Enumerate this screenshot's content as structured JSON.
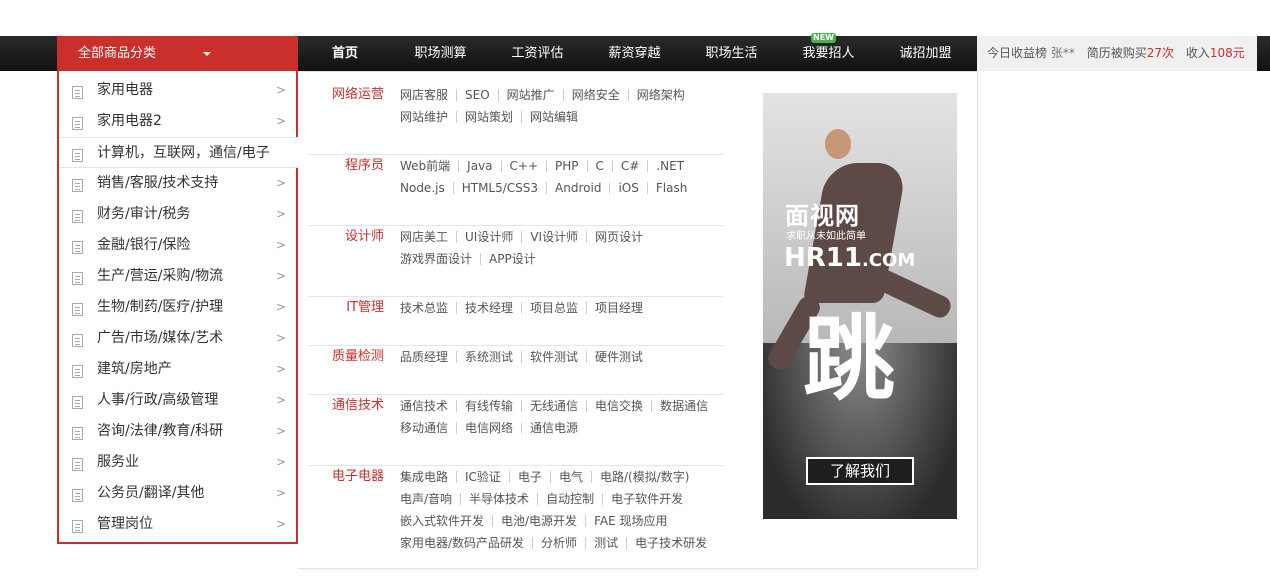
{
  "category_header": {
    "label": "全部商品分类"
  },
  "nav": {
    "items": [
      {
        "label": "首页"
      },
      {
        "label": "职场测算"
      },
      {
        "label": "工资评估"
      },
      {
        "label": "薪资穿越"
      },
      {
        "label": "职场生活"
      },
      {
        "label": "我要招人",
        "badge": "NEW"
      },
      {
        "label": "诚招加盟"
      }
    ]
  },
  "stats": {
    "label": "今日收益榜",
    "user": "张**",
    "resume_prefix": "简历被购买",
    "resume_count": "27次",
    "income_prefix": "收入",
    "income_value": "108元"
  },
  "sidebar": {
    "items": [
      {
        "label": "家用电器"
      },
      {
        "label": "家用电器2"
      },
      {
        "label": "计算机，互联网，通信/电子"
      },
      {
        "label": "销售/客服/技术支持"
      },
      {
        "label": "财务/审计/税务"
      },
      {
        "label": "金融/银行/保险"
      },
      {
        "label": "生产/营运/采购/物流"
      },
      {
        "label": "生物/制药/医疗/护理"
      },
      {
        "label": "广告/市场/媒体/艺术"
      },
      {
        "label": "建筑/房地产"
      },
      {
        "label": "人事/行政/高级管理"
      },
      {
        "label": "咨询/法律/教育/科研"
      },
      {
        "label": "服务业"
      },
      {
        "label": "公务员/翻译/其他"
      },
      {
        "label": "管理岗位"
      }
    ]
  },
  "groups": [
    {
      "title": "网络运营",
      "rows": [
        [
          "网店客服",
          "SEO",
          "网站推广",
          "网络安全",
          "网络架构"
        ],
        [
          "网站维护",
          "网站策划",
          "网站编辑"
        ]
      ]
    },
    {
      "title": "程序员",
      "rows": [
        [
          "Web前端",
          "Java",
          "C++",
          "PHP",
          "C",
          "C#",
          ".NET"
        ],
        [
          "Node.js",
          "HTML5/CSS3",
          "Android",
          "iOS",
          "Flash"
        ]
      ]
    },
    {
      "title": "设计师",
      "rows": [
        [
          "网店美工",
          "UI设计师",
          "VI设计师",
          "网页设计"
        ],
        [
          "游戏界面设计",
          "APP设计"
        ]
      ]
    },
    {
      "title": "IT管理",
      "rows": [
        [
          "技术总监",
          "技术经理",
          "项目总监",
          "项目经理"
        ]
      ]
    },
    {
      "title": "质量检测",
      "rows": [
        [
          "品质经理",
          "系统测试",
          "软件测试",
          "硬件测试"
        ]
      ]
    },
    {
      "title": "通信技术",
      "rows": [
        [
          "通信技术",
          "有线传输",
          "无线通信",
          "电信交换",
          "数据通信"
        ],
        [
          "移动通信",
          "电信网络",
          "通信电源"
        ]
      ]
    },
    {
      "title": "电子电器",
      "rows": [
        [
          "集成电路",
          "IC验证",
          "电子",
          "电气",
          "电路/(模拟/数字)"
        ],
        [
          "电声/音响",
          "半导体技术",
          "自动控制",
          "电子软件开发"
        ],
        [
          "嵌入式软件开发",
          "电池/电源开发",
          "FAE 现场应用"
        ],
        [
          "家用电器/数码产品研发",
          "分析师",
          "测试",
          "电子技术研发"
        ]
      ]
    }
  ],
  "ad": {
    "brand": "面视网",
    "slogan": "求职从未如此简单",
    "domain_main": "HR11",
    "domain_suffix": ".COM",
    "big_char": "跳",
    "cta": "了解我们"
  }
}
